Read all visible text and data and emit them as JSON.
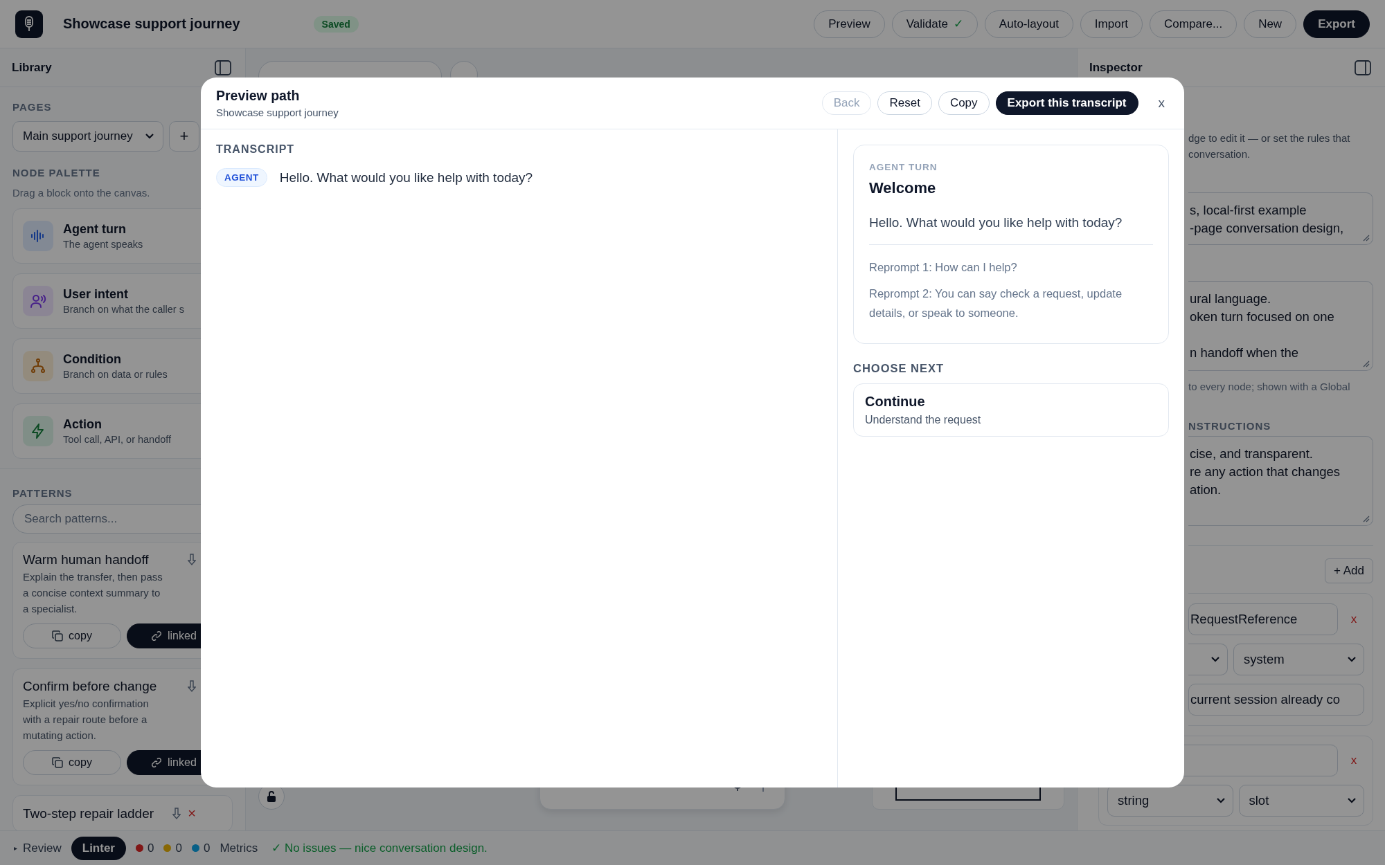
{
  "app_bar": {
    "title": "Showcase support journey",
    "status_badge": "Saved",
    "actions": [
      {
        "label": "Preview",
        "kind": "outline"
      },
      {
        "label": "Validate",
        "kind": "outline",
        "tick": "✓"
      },
      {
        "label": "Auto-layout",
        "kind": "outline"
      },
      {
        "label": "Import",
        "kind": "outline"
      },
      {
        "label": "Compare...",
        "kind": "outline"
      },
      {
        "label": "New",
        "kind": "outline"
      },
      {
        "label": "Export",
        "kind": "primary"
      }
    ]
  },
  "library": {
    "title": "Library",
    "pages_label": "PAGES",
    "page_select": "Main support journey",
    "add_page": "+",
    "palette_label": "NODE PALETTE",
    "palette_hint": "Drag a block onto the canvas.",
    "blocks": [
      {
        "kind": "agent",
        "title": "Agent turn",
        "subtitle": "The agent speaks"
      },
      {
        "kind": "intent",
        "title": "User intent",
        "subtitle": "Branch on what the caller s"
      },
      {
        "kind": "condition",
        "title": "Condition",
        "subtitle": "Branch on data or rules"
      },
      {
        "kind": "action",
        "title": "Action",
        "subtitle": "Tool call, API, or handoff"
      }
    ],
    "patterns_label": "PATTERNS",
    "search": {
      "placeholder": "Search patterns..."
    },
    "patterns": [
      {
        "title": "Warm human handoff",
        "description": "Explain the transfer, then pass a concise context summary to a specialist.",
        "copy": "copy",
        "linked": "linked"
      },
      {
        "title": "Confirm before change",
        "description": "Explicit yes/no confirmation with a repair route before a mutating action.",
        "copy": "copy",
        "linked": "linked"
      },
      {
        "title": "Two-step repair ladder",
        "remove": "×"
      }
    ]
  },
  "inspector": {
    "title": "Inspector",
    "description_lines": [
      "dge to edit it — or set the rules that",
      "conversation."
    ],
    "about_box": [
      "s, local-first example",
      "-page conversation design,"
    ],
    "rules_box": [
      [
        "ural language.",
        "oken turn focused on one"
      ],
      [
        "n handoff when the"
      ]
    ],
    "hint": "to every node; shown with a Global",
    "section_label": "NSTRUCTIONS",
    "section_box": [
      "cise, and transparent.",
      "re any action that changes",
      "ation."
    ],
    "add_button": "+ Add",
    "variables": [
      {
        "kind": "clipped",
        "name": "RequestReference",
        "source": "system",
        "value": "current session already co",
        "remove": "x"
      },
      {
        "kind": "full",
        "type": "string",
        "source": "slot",
        "remove": "x"
      }
    ]
  },
  "dialog": {
    "title": "Preview path",
    "subtitle": "Showcase support journey",
    "actions": [
      {
        "label": "Back",
        "kind": "outline",
        "disabled": true
      },
      {
        "label": "Reset",
        "kind": "outline",
        "disabled": false
      },
      {
        "label": "Copy",
        "kind": "outline",
        "disabled": false
      },
      {
        "label": "Export this transcript",
        "kind": "primary",
        "disabled": false
      }
    ],
    "close": "x",
    "transcript": {
      "label": "TRANSCRIPT",
      "messages": [
        {
          "speaker": "AGENT",
          "text": "Hello. What would you like help with today?"
        }
      ]
    },
    "turn": {
      "label": "AGENT TURN",
      "title": "Welcome",
      "prompt": "Hello. What would you like help with today?",
      "reprompts": [
        "Reprompt 1: How can I help?",
        "Reprompt 2: You can say check a request, update details, or speak to someone."
      ]
    },
    "next_label": "CHOOSE NEXT",
    "options": [
      {
        "title": "Continue",
        "subtitle": "Understand the request"
      }
    ]
  },
  "status_bar": {
    "tabs": [
      {
        "label": "Review",
        "caret": "▸",
        "selected": false
      },
      {
        "label": "Linter",
        "selected": true,
        "counts": [
          {
            "color": "#801616",
            "value": "0"
          },
          {
            "color": "#886805",
            "value": "0"
          },
          {
            "color": "#086087",
            "value": "0"
          }
        ]
      },
      {
        "label": "Metrics",
        "selected": false
      }
    ],
    "message": "✓ No issues — nice conversation design."
  }
}
